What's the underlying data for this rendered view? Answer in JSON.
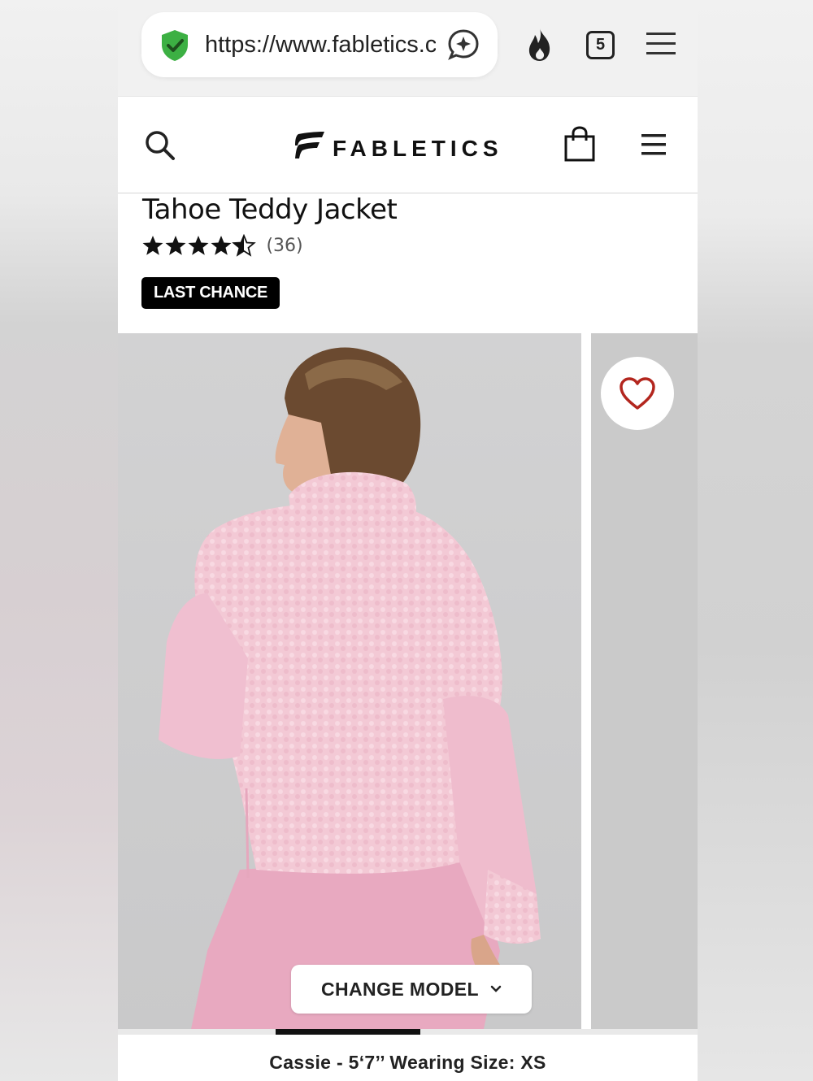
{
  "browser": {
    "url": "https://www.fabletics.com",
    "tab_count": "5"
  },
  "site": {
    "brand": "FABLETICS"
  },
  "product": {
    "title": "Tahoe Teddy Jacket",
    "rating": 4.5,
    "review_count": "(36)",
    "badge": "LAST CHANCE"
  },
  "gallery": {
    "change_model_label": "CHANGE MODEL",
    "model_caption": "Cassie - 5‘7’’ Wearing Size: XS",
    "progress": 0.25
  },
  "icons": {
    "secure": "shield-check-icon",
    "ai": "sparkle-chat-icon",
    "fire": "fire-icon",
    "favorite": "heart-icon"
  },
  "colors": {
    "secure_green": "#3cb043",
    "heart_red": "#b3261e",
    "jacket_pink": "#f2c4d2"
  }
}
